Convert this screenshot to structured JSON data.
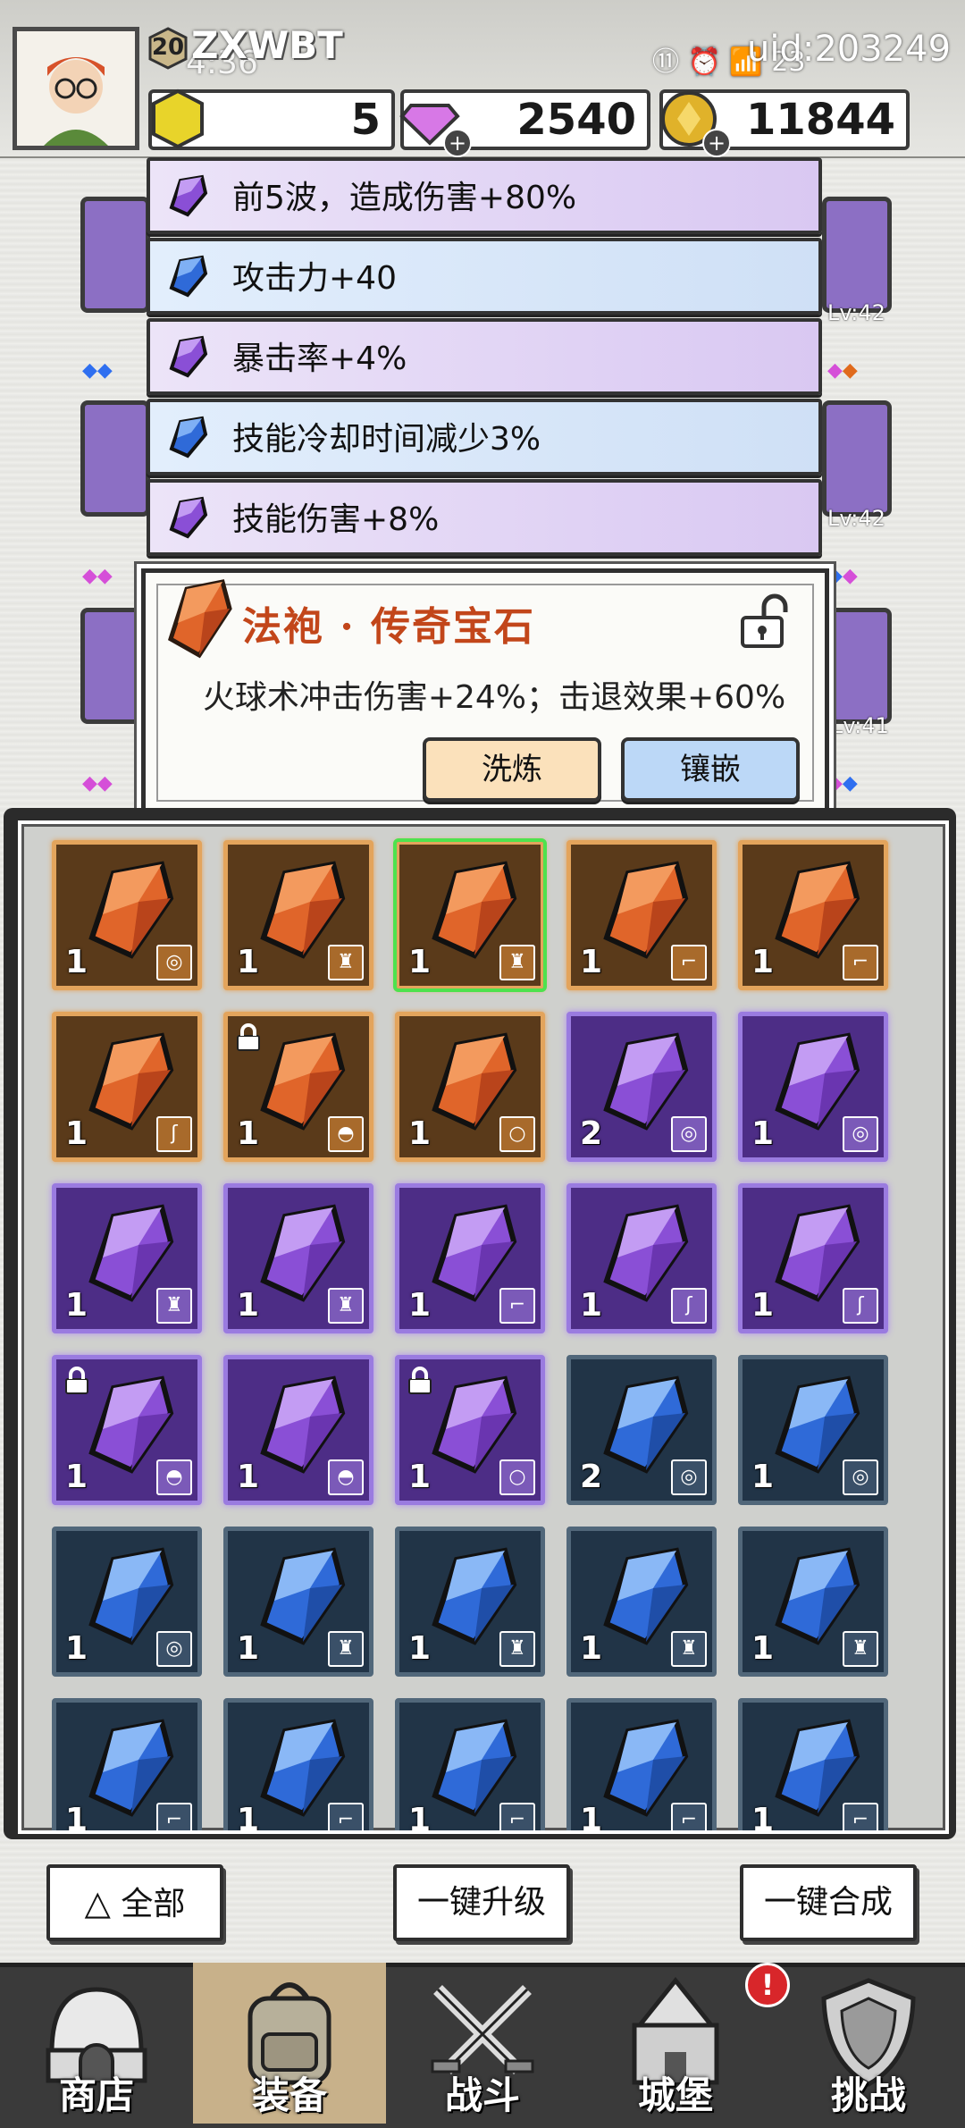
{
  "player": {
    "level": "20",
    "name": "ZXWBT",
    "sub": "4:36",
    "uid": "uid:203249",
    "status_icons": "⑪ ⏰ 📶 23"
  },
  "resources": {
    "gold_block": "5",
    "diamonds": "2540",
    "coins": "11844"
  },
  "hero_levels": [
    "Lv:42",
    "Lv:42",
    "Lv:41"
  ],
  "attributes": [
    {
      "text": "前5波，造成伤害+80%",
      "color": "purple"
    },
    {
      "text": "攻击力+40",
      "color": "blue"
    },
    {
      "text": "暴击率+4%",
      "color": "purple"
    },
    {
      "text": "技能冷却时间减少3%",
      "color": "blue"
    },
    {
      "text": "技能伤害+8%",
      "color": "purple"
    }
  ],
  "popup": {
    "title": "法袍 · 传奇宝石",
    "description": "火球术冲击伤害+24%；击退效果+60%",
    "refine_label": "洗炼",
    "inlay_label": "镶嵌"
  },
  "inventory": [
    {
      "rarity": "legend",
      "count": "1",
      "slot": "ring",
      "selected": false,
      "locked": false
    },
    {
      "rarity": "legend",
      "count": "1",
      "slot": "robe",
      "selected": false,
      "locked": false
    },
    {
      "rarity": "legend",
      "count": "1",
      "slot": "robe",
      "selected": true,
      "locked": false
    },
    {
      "rarity": "legend",
      "count": "1",
      "slot": "boot",
      "selected": false,
      "locked": false
    },
    {
      "rarity": "legend",
      "count": "1",
      "slot": "boot",
      "selected": false,
      "locked": false
    },
    {
      "rarity": "legend",
      "count": "1",
      "slot": "staff",
      "selected": false,
      "locked": false
    },
    {
      "rarity": "legend",
      "count": "1",
      "slot": "hat",
      "selected": false,
      "locked": true
    },
    {
      "rarity": "legend",
      "count": "1",
      "slot": "necklace",
      "selected": false,
      "locked": false
    },
    {
      "rarity": "epic",
      "count": "2",
      "slot": "ring",
      "selected": false,
      "locked": false
    },
    {
      "rarity": "epic",
      "count": "1",
      "slot": "ring",
      "selected": false,
      "locked": false
    },
    {
      "rarity": "epic",
      "count": "1",
      "slot": "robe",
      "selected": false,
      "locked": false
    },
    {
      "rarity": "epic",
      "count": "1",
      "slot": "robe",
      "selected": false,
      "locked": false
    },
    {
      "rarity": "epic",
      "count": "1",
      "slot": "boot",
      "selected": false,
      "locked": false
    },
    {
      "rarity": "epic",
      "count": "1",
      "slot": "staff",
      "selected": false,
      "locked": false
    },
    {
      "rarity": "epic",
      "count": "1",
      "slot": "staff",
      "selected": false,
      "locked": false
    },
    {
      "rarity": "epic",
      "count": "1",
      "slot": "hat",
      "selected": false,
      "locked": true
    },
    {
      "rarity": "epic",
      "count": "1",
      "slot": "hat",
      "selected": false,
      "locked": false
    },
    {
      "rarity": "epic",
      "count": "1",
      "slot": "necklace",
      "selected": false,
      "locked": true
    },
    {
      "rarity": "rare",
      "count": "2",
      "slot": "ring",
      "selected": false,
      "locked": false
    },
    {
      "rarity": "rare",
      "count": "1",
      "slot": "ring",
      "selected": false,
      "locked": false
    },
    {
      "rarity": "rare",
      "count": "1",
      "slot": "ring",
      "selected": false,
      "locked": false
    },
    {
      "rarity": "rare",
      "count": "1",
      "slot": "robe",
      "selected": false,
      "locked": false
    },
    {
      "rarity": "rare",
      "count": "1",
      "slot": "robe",
      "selected": false,
      "locked": false
    },
    {
      "rarity": "rare",
      "count": "1",
      "slot": "robe",
      "selected": false,
      "locked": false
    },
    {
      "rarity": "rare",
      "count": "1",
      "slot": "robe",
      "selected": false,
      "locked": false
    },
    {
      "rarity": "rare",
      "count": "1",
      "slot": "boot",
      "selected": false,
      "locked": false
    },
    {
      "rarity": "rare",
      "count": "1",
      "slot": "boot",
      "selected": false,
      "locked": false
    },
    {
      "rarity": "rare",
      "count": "1",
      "slot": "boot",
      "selected": false,
      "locked": false
    },
    {
      "rarity": "rare",
      "count": "1",
      "slot": "boot",
      "selected": false,
      "locked": false
    },
    {
      "rarity": "rare",
      "count": "1",
      "slot": "boot",
      "selected": false,
      "locked": false
    }
  ],
  "actions": {
    "filter_label": "全部",
    "upgrade_label": "一键升级",
    "merge_label": "一键合成"
  },
  "nav": [
    {
      "label": "商店",
      "icon": "shop-icon",
      "active": false
    },
    {
      "label": "装备",
      "icon": "backpack-icon",
      "active": true
    },
    {
      "label": "战斗",
      "icon": "crossed-swords-icon",
      "active": false
    },
    {
      "label": "城堡",
      "icon": "castle-icon",
      "active": false
    },
    {
      "label": "挑战",
      "icon": "shield-icon",
      "active": false
    }
  ],
  "castle_alert": "!",
  "colors": {
    "legend": "#e3a45c",
    "epic": "#9a7be0",
    "rare": "#51677a",
    "title_orange": "#c2461a"
  }
}
